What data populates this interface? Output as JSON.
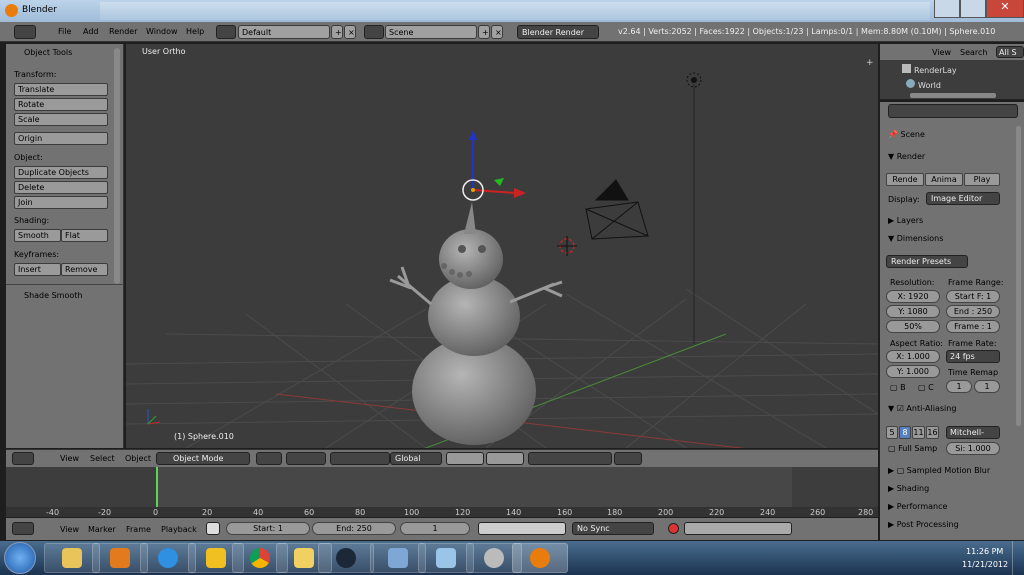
{
  "window": {
    "title": "Blender"
  },
  "topbar": {
    "menus": [
      "File",
      "Add",
      "Render",
      "Window",
      "Help"
    ],
    "layout": "Default",
    "scene": "Scene",
    "engine": "Blender Render",
    "info": "v2.64 | Verts:2052 | Faces:1922 | Objects:1/23 | Lamps:0/1 | Mem:8.80M (0.10M) | Sphere.010"
  },
  "toolshelf": {
    "title": "Object Tools",
    "transform_label": "Transform:",
    "translate": "Translate",
    "rotate": "Rotate",
    "scale": "Scale",
    "origin": "Origin",
    "object_label": "Object:",
    "duplicate": "Duplicate Objects",
    "delete": "Delete",
    "join": "Join",
    "shading_label": "Shading:",
    "smooth": "Smooth",
    "flat": "Flat",
    "keyframes_label": "Keyframes:",
    "insert": "Insert",
    "remove": "Remove",
    "shade_smooth": "Shade Smooth"
  },
  "viewport": {
    "view_label": "User Ortho",
    "object_label": "(1) Sphere.010"
  },
  "vpheader": {
    "menus": [
      "View",
      "Select",
      "Object"
    ],
    "mode": "Object Mode",
    "orientation": "Global"
  },
  "timeline": {
    "ruler": [
      "-40",
      "-20",
      "0",
      "20",
      "40",
      "60",
      "80",
      "100",
      "120",
      "140",
      "160",
      "180",
      "200",
      "220",
      "240",
      "260",
      "280"
    ],
    "menus": [
      "View",
      "Marker",
      "Frame",
      "Playback"
    ],
    "start": "Start: 1",
    "end": "End: 250",
    "current": "1",
    "sync": "No Sync"
  },
  "outliner": {
    "view": "View",
    "search": "Search",
    "all": "All S",
    "items": [
      "RenderLay",
      "World"
    ]
  },
  "properties": {
    "scene": "Scene",
    "render_header": "Render",
    "render_btn": "Rende",
    "anim_btn": "Anima",
    "play_btn": "Play",
    "display_label": "Display:",
    "display_value": "Image Editor",
    "layers": "Layers",
    "dimensions": "Dimensions",
    "presets": "Render Presets",
    "resolution_label": "Resolution:",
    "res_x": "X: 1920",
    "res_y": "Y: 1080",
    "res_pct": "50%",
    "frame_range_label": "Frame Range:",
    "start_f": "Start F: 1",
    "end_f": "End : 250",
    "frame": "Frame : 1",
    "aspect_label": "Aspect Ratio:",
    "asp_x": "X: 1.000",
    "asp_y": "Y: 1.000",
    "framerate_label": "Frame Rate:",
    "fps": "24 fps",
    "time_remap": "Time Remap",
    "remap_a": "1",
    "remap_b": "1",
    "b": "B",
    "c": "C",
    "aa": "Anti-Aliasing",
    "aa_levels": [
      "5",
      "8",
      "11",
      "16"
    ],
    "aa_filter": "Mitchell-",
    "full_samp": "Full Samp",
    "size": "Si: 1.000",
    "motion_blur": "Sampled Motion Blur",
    "shading": "Shading",
    "performance": "Performance",
    "post_processing": "Post Processing"
  },
  "taskbar": {
    "time": "11:26 PM",
    "date": "11/21/2012"
  }
}
